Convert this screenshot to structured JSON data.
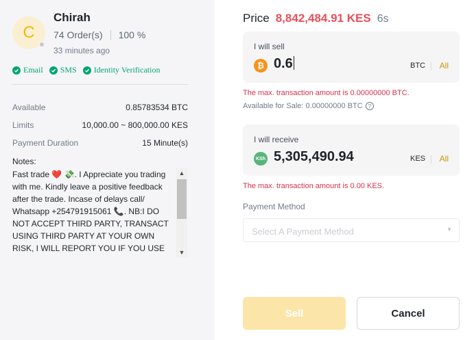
{
  "seller": {
    "initial": "C",
    "name": "Chirah",
    "orders": "74 Order(s)",
    "completion": "100 %",
    "last_seen": "33 minutes ago",
    "verifications": [
      {
        "label": "Email"
      },
      {
        "label": "SMS"
      },
      {
        "label": "Identity Verification"
      }
    ]
  },
  "details": {
    "available_label": "Available",
    "available_value": "0.85783534 BTC",
    "limits_label": "Limits",
    "limits_value": "10,000.00 ~ 800,000.00 KES",
    "duration_label": "Payment Duration",
    "duration_value": "15 Minute(s)",
    "notes_label": "Notes:",
    "notes_text": "Fast trade ❤️ 💸. I Appreciate you trading with me. Kindly leave a positive feedback after the trade. Incase of delays call/ Whatsapp +254791915061 📞. NB:I DO NOT ACCEPT THIRD PARTY, TRANSACT USING THIRD PARTY AT YOUR OWN RISK, I WILL REPORT YOU IF YOU USE THIRD"
  },
  "price": {
    "label": "Price",
    "value": "8,842,484.91 KES",
    "timer": "6s"
  },
  "sell_box": {
    "label": "I will sell",
    "value": "0.6",
    "unit": "BTC",
    "all": "All",
    "error": "The max. transaction amount is 0.00000000 BTC.",
    "available": "Available for Sale: 0.00000000 BTC"
  },
  "receive_box": {
    "label": "I will receive",
    "coin_text": "KSh",
    "value": "5,305,490.94",
    "unit": "KES",
    "all": "All",
    "error": "The max. transaction amount is 0.00 KES."
  },
  "payment": {
    "label": "Payment Method",
    "placeholder": "Select A Payment Method"
  },
  "actions": {
    "sell": "Sell",
    "cancel": "Cancel"
  },
  "colors": {
    "accent": "#F0B90B",
    "price_red": "#E84F5A",
    "error_red": "#D9304E",
    "success_green": "#03A66D",
    "btc_orange": "#F7931A"
  }
}
